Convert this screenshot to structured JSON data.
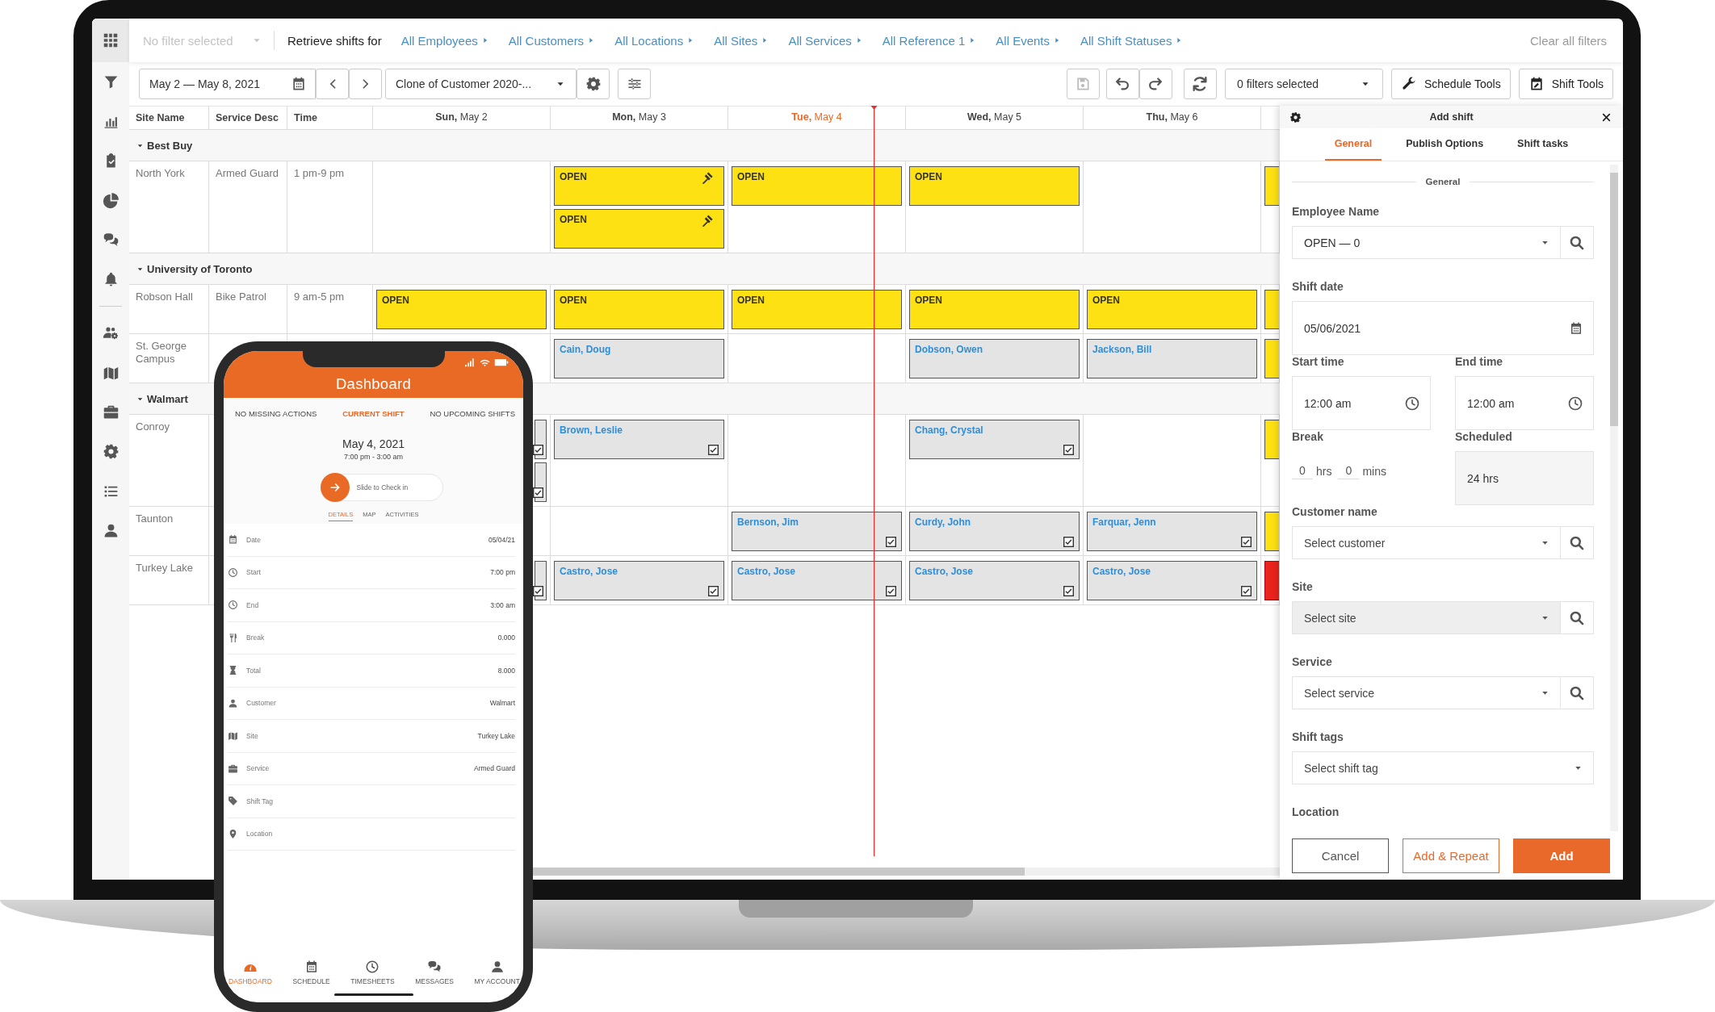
{
  "topbar": {
    "filter": {
      "placeholder": "No filter selected"
    },
    "retrieve_label": "Retrieve shifts for",
    "filters": [
      "All Employees",
      "All Customers",
      "All Locations",
      "All Sites",
      "All Services",
      "All Reference 1",
      "All Events",
      "All Shift Statuses"
    ],
    "clear": "Clear all filters"
  },
  "toolbar": {
    "date_range": "May 2 — May 8, 2021",
    "schedule": "Clone of Customer 2020-...",
    "save": {
      "disabled": true
    },
    "filters_dropdown": "0 filters selected",
    "tools": [
      "Schedule Tools",
      "Shift Tools"
    ]
  },
  "grid": {
    "columns": [
      "Site Name",
      "Service Desc",
      "Time"
    ],
    "days": [
      {
        "label": "**Sun,** May 2",
        "today": false
      },
      {
        "label": "**Mon,** May 3",
        "today": false
      },
      {
        "label": "**Tue,** May 4",
        "today": true
      },
      {
        "label": "**Wed,** May 5",
        "today": false
      },
      {
        "label": "**Thu,** May 6",
        "today": false
      }
    ],
    "groups": [
      {
        "name": "Best Buy",
        "expanded": true,
        "rows": [
          {
            "site": "North York",
            "service": "Armed Guard",
            "time": "1 pm-9 pm",
            "cells": [
              [],
              [
                {
                  "kind": "open",
                  "label": "OPEN",
                  "bidding": true
                },
                {
                  "kind": "open",
                  "label": "OPEN",
                  "bidding": true
                }
              ],
              [
                {
                  "kind": "open",
                  "label": "OPEN",
                  "bidding": false
                }
              ],
              [
                {
                  "kind": "open",
                  "label": "OPEN",
                  "bidding": false
                }
              ],
              [],
              [
                {
                  "kind": "open"
                }
              ]
            ]
          }
        ]
      },
      {
        "name": "University of Toronto",
        "expanded": true,
        "rows": [
          {
            "site": "Robson Hall",
            "service": "Bike Patrol",
            "time": "9 am-5 pm",
            "cells": [
              [
                {
                  "kind": "open",
                  "label": "OPEN",
                  "bidding": false
                }
              ],
              [
                {
                  "kind": "open",
                  "label": "OPEN",
                  "bidding": false
                }
              ],
              [
                {
                  "kind": "open",
                  "label": "OPEN",
                  "bidding": false
                }
              ],
              [
                {
                  "kind": "open",
                  "label": "OPEN",
                  "bidding": false
                }
              ],
              [
                {
                  "kind": "open",
                  "label": "OPEN",
                  "bidding": false
                }
              ],
              [
                {
                  "kind": "open"
                }
              ]
            ]
          },
          {
            "site": "St. George Campus",
            "cells": [
              [],
              [
                {
                  "kind": "assigned",
                  "name": "Cain, Doug"
                }
              ],
              [],
              [
                {
                  "kind": "assigned",
                  "name": "Dobson, Owen"
                }
              ],
              [
                {
                  "kind": "assigned",
                  "name": "Jackson, Bill"
                }
              ],
              [
                {
                  "kind": "open"
                }
              ]
            ]
          }
        ]
      },
      {
        "name": "Walmart",
        "expanded": true,
        "rows": [
          {
            "site": "Conroy",
            "cells": [
              [
                {
                  "kind": "assigned",
                  "checked": true
                },
                {
                  "kind": "assigned",
                  "checked": true
                }
              ],
              [
                {
                  "kind": "assigned",
                  "name": "Brown, Leslie",
                  "checked": true
                }
              ],
              [],
              [
                {
                  "kind": "assigned",
                  "name": "Chang, Crystal",
                  "checked": true
                }
              ],
              [],
              [
                {
                  "kind": "open"
                }
              ]
            ]
          },
          {
            "site": "Taunton",
            "cells": [
              [],
              [],
              [
                {
                  "kind": "assigned",
                  "name": "Bernson, Jim",
                  "checked": true
                }
              ],
              [
                {
                  "kind": "assigned",
                  "name": "Curdy, John",
                  "checked": true
                }
              ],
              [
                {
                  "kind": "assigned",
                  "name": "Farquar, Jenn",
                  "checked": true
                }
              ],
              [
                {
                  "kind": "open"
                }
              ]
            ]
          },
          {
            "site": "Turkey Lake",
            "cells": [
              [
                {
                  "kind": "assigned",
                  "checked": true
                }
              ],
              [
                {
                  "kind": "assigned",
                  "name": "Castro, Jose",
                  "checked": true
                }
              ],
              [
                {
                  "kind": "assigned",
                  "name": "Castro, Jose",
                  "checked": true
                }
              ],
              [
                {
                  "kind": "assigned",
                  "name": "Castro, Jose",
                  "checked": true
                }
              ],
              [
                {
                  "kind": "assigned",
                  "name": "Castro, Jose",
                  "checked": true
                }
              ],
              [
                {
                  "kind": "alert"
                }
              ]
            ]
          }
        ]
      }
    ]
  },
  "panel": {
    "title": "Add shift",
    "tabs": [
      {
        "label": "General",
        "selected": true
      },
      {
        "label": "Publish Options",
        "selected": false
      },
      {
        "label": "Shift tasks",
        "selected": false
      }
    ],
    "section": "General",
    "fields": [
      {
        "kind": "select",
        "label": "Employee Name",
        "value": "OPEN — 0",
        "search": true,
        "disabled": false
      },
      {
        "kind": "date",
        "label": "Shift date",
        "value": "05/06/2021"
      },
      {
        "kind": "time_pair",
        "items": [
          {
            "label": "Start time",
            "value": "12:00 am"
          },
          {
            "label": "End time",
            "value": "12:00 am"
          }
        ]
      },
      {
        "kind": "break",
        "label": "Break",
        "hours": "0",
        "hours_unit": "hrs",
        "minutes": "0",
        "minutes_unit": "mins",
        "scheduled_label": "Scheduled",
        "scheduled": "24 hrs"
      },
      {
        "kind": "select",
        "label": "Customer name",
        "placeholder": "Select customer",
        "search": true,
        "disabled": false
      },
      {
        "kind": "select",
        "label": "Site",
        "placeholder": "Select site",
        "search": true,
        "disabled": true
      },
      {
        "kind": "select",
        "label": "Service",
        "placeholder": "Select service",
        "search": true,
        "disabled": false
      },
      {
        "kind": "select",
        "label": "Shift tags",
        "placeholder": "Select shift tag",
        "search": false,
        "disabled": false
      },
      {
        "kind": "heading",
        "label": "Location"
      }
    ],
    "buttons": [
      {
        "label": "Cancel",
        "kind": "default"
      },
      {
        "label": "Add & Repeat",
        "kind": "outline"
      },
      {
        "label": "Add",
        "kind": "primary"
      }
    ]
  },
  "phone": {
    "title": "Dashboard",
    "tabs": [
      {
        "label": "NO MISSING ACTIONS",
        "selected": false
      },
      {
        "label": "CURRENT SHIFT",
        "selected": true
      },
      {
        "label": "NO UPCOMING SHIFTS",
        "selected": false
      }
    ],
    "date": "May 4, 2021",
    "hours": "7:00 pm - 3:00 am",
    "slide": "Slide to Check in",
    "subtabs": [
      {
        "label": "DETAILS",
        "selected": true
      },
      {
        "label": "MAP",
        "selected": false
      },
      {
        "label": "ACTIVITIES",
        "selected": false
      }
    ],
    "details": [
      {
        "label": "Date",
        "value": "05/04/21"
      },
      {
        "label": "Start",
        "value": "7:00 pm"
      },
      {
        "label": "End",
        "value": "3:00 am"
      },
      {
        "label": "Break",
        "value": "0.000"
      },
      {
        "label": "Total",
        "value": "8.000"
      },
      {
        "label": "Customer",
        "value": "Walmart"
      },
      {
        "label": "Site",
        "value": "Turkey Lake"
      },
      {
        "label": "Service",
        "value": "Armed Guard"
      },
      {
        "label": "Shift Tag"
      },
      {
        "label": "Location"
      }
    ],
    "nav": [
      {
        "label": "DASHBOARD",
        "selected": true
      },
      {
        "label": "SCHEDULE",
        "selected": false
      },
      {
        "label": "TIMESHEETS",
        "selected": false
      },
      {
        "label": "MESSAGES",
        "selected": false
      },
      {
        "label": "MY ACCOUNT",
        "selected": false
      }
    ]
  }
}
